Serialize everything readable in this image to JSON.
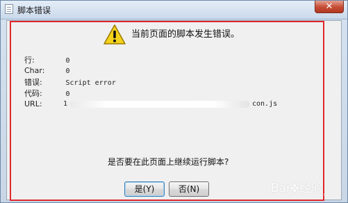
{
  "window": {
    "title": "脚本错误",
    "close_glyph": "✕"
  },
  "dialog": {
    "message": "当前页面的脚本发生错误。",
    "icon": "warning-icon",
    "details": [
      {
        "label": "行:",
        "value": "0"
      },
      {
        "label": "Char:",
        "value": "0"
      },
      {
        "label": "错误:",
        "value": "Script error"
      },
      {
        "label": "代码:",
        "value": "0"
      },
      {
        "label": "URL:",
        "value_start": "1",
        "value_end": "con.js"
      }
    ],
    "question": "是否要在此页面上继续运行脚本?",
    "buttons": {
      "yes": "是(Y)",
      "no": "否(N)"
    }
  },
  "watermark": {
    "brand_start": "Bai",
    "brand_end": "经验",
    "sub": "jingyan.baidu.com"
  },
  "colors": {
    "annotation_red": "#e0282d",
    "titlebar": "#cad9eb",
    "dialog_bg": "#f0f0f0",
    "close_red": "#c54b33"
  }
}
